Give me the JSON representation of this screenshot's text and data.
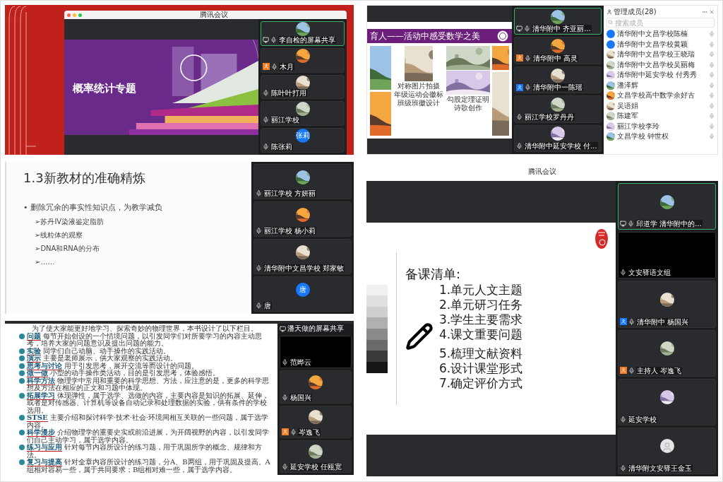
{
  "top_left": {
    "window_title": "腾讯会议",
    "slide_title": "概率统计专题",
    "tiles": [
      {
        "name": "李自检的屏幕共享",
        "screen": true,
        "active": true
      },
      {
        "name": "木月",
        "screen": false,
        "color": "#f07c28",
        "active": false
      },
      {
        "name": "陈叶叶打用",
        "screen": false,
        "active": false
      },
      {
        "name": "丽江学校",
        "screen": false,
        "active": false
      },
      {
        "name": "陈张莉",
        "avatar": {
          "kind": "letter",
          "text": "张莉"
        },
        "screen": false,
        "active": false
      }
    ]
  },
  "top_right": {
    "slide_title": "育人——活动中感受数学之美",
    "captions": [
      [
        "对称图片拍摄",
        "年级运动会徽标",
        "班级班徽设计"
      ],
      [
        "勾股定理证明",
        "诗歌创作"
      ]
    ],
    "tiles": [
      {
        "name": "清华附中 齐亚丽...",
        "screen": true,
        "active": true
      },
      {
        "name": "清华附中 高灵",
        "screen": false,
        "color": "#f07c28",
        "active": false
      },
      {
        "name": "清华附中一陈瑶",
        "screen": false,
        "color": "#1677ff",
        "active": false
      },
      {
        "name": "丽江学校罗丹丹",
        "screen": false,
        "active": false
      },
      {
        "name": "清华附中延安学校 付...",
        "screen": false,
        "active": false
      }
    ],
    "members_title": "管理成员(28)",
    "search_placeholder": "搜索成员",
    "members": [
      {
        "name": "清华附中文昌学校陈楠",
        "avatar": {
          "kind": "blue"
        }
      },
      {
        "name": "清华附中文昌学校黄颖",
        "avatar": {
          "kind": "blue"
        }
      },
      {
        "name": "清华附中文昌学校王晓瑞"
      },
      {
        "name": "清华附中文昌学校吴丽梅"
      },
      {
        "name": "清华附中延安学校 付秀秀"
      },
      {
        "name": "潘泽辉"
      },
      {
        "name": "文昌学校高中数学余好古"
      },
      {
        "name": "吴语娟"
      },
      {
        "name": "陈建军"
      },
      {
        "name": "丽江学校李玲"
      },
      {
        "name": "文昌学校 钟世权"
      }
    ]
  },
  "middle_left": {
    "slide_title": "1.3新教材的准确精炼",
    "bullet": "• 删除冗余的事实性知识点，为教学减负",
    "sub_items": [
      "➢苏丹IV染液鉴定脂肪",
      "➢线粒体的观察",
      "➢DNA和RNA的分布",
      "➢……"
    ],
    "tiles": [
      {
        "name": "丽江学校 方妍丽",
        "screen": false,
        "active": false
      },
      {
        "name": "丽江学校 杨小莉",
        "screen": false,
        "active": false
      },
      {
        "name": "清华附中文昌学校 郑家敏",
        "screen": false,
        "active": false
      },
      {
        "name": "唐",
        "avatar": {
          "kind": "letter",
          "text": "唐"
        },
        "screen": false,
        "active": false
      }
    ]
  },
  "bottom_left": {
    "share_label": "潘天做的屏幕共享",
    "intro": "为了使大家能更好地学习、探索奇妙的物理世界，本书设计了以下栏目。",
    "items": [
      {
        "term": "问题",
        "text": "每节开始创设的一个情境问题，以引发同学们对所要学习的内容主动思考，培养大家的问题意识及提出问题的能力。"
      },
      {
        "term": "实验",
        "text": "同学们自己动脑、动手操作的实践活动。"
      },
      {
        "term": "演示",
        "text": "主要是老师展示，供大家观察的实践活动。"
      },
      {
        "term": "思考与讨论",
        "text": "用于引发思考，展开交流等而设计的问题。"
      },
      {
        "term": "做一做",
        "text": "小型的动手操作类活动，目的是引发思考，体验感悟。"
      },
      {
        "term": "科学方法",
        "text": "物理学中常用和重要的科学思想、方法，应注意的是，更多的科学思想及方法在相应的正文和习题中体现。"
      },
      {
        "term": "拓展学习",
        "text": "体现弹性，属于选学、选做的内容，主要内容是知识的拓展、延伸，或者是对传感器、计算机等设备自动记录和处理数据的实验，供有条件的学校选用。"
      },
      {
        "term": "STSE",
        "text": "主要介绍和探讨科学·技术·社会·环境间相互关联的一些问题，属于选学内容。"
      },
      {
        "term": "科学漫步",
        "text": "介绍物理学的重要史实或前沿进展，为开阔视野的内容，以引发同学们自己主动学习，属于选学内容。"
      },
      {
        "term": "练习与应用",
        "text": "针对每节内容所设计的练习题，用于巩固所学的概念、规律和方法。"
      },
      {
        "term": "复习与提高",
        "text": "针对全章内容所设计的练习题，分A、B两组，用于巩固及提高。A组相对容易一些，属于共同要求；B组相对难一些，属于选学内容。"
      }
    ],
    "tiles": [
      {
        "name": "范晔云",
        "avatar": {
          "kind": "blank"
        },
        "screen": false,
        "active": false
      },
      {
        "name": "杨国兴",
        "screen": false,
        "active": false
      },
      {
        "name": "岑逸飞",
        "screen": false,
        "color": "#f07c28",
        "active": false
      },
      {
        "name": "延安学校 任瓯宽",
        "screen": false,
        "active": false
      }
    ]
  },
  "bottom_right": {
    "window_title": "腾讯会议",
    "heading": "备课清单:",
    "items": [
      "1.单元人文主题",
      "2.单元研习任务",
      "3.学生主要需求",
      "4.课文重要问题",
      "5.梳理文献资料",
      "6.设计课堂形式",
      "7.确定评价方式"
    ],
    "tiles": [
      {
        "name": "邱道学 清华附中的...",
        "screen": true,
        "active": true
      },
      {
        "name": "文安驿语文组",
        "avatar": {
          "kind": "blank"
        },
        "screen": false,
        "active": false
      },
      {
        "name": "清华附中 杨国兴",
        "screen": false,
        "color": "#1677ff",
        "active": false
      },
      {
        "name": "主持人 岑逸飞",
        "screen": false,
        "color": "#f07c28",
        "active": false
      },
      {
        "name": "延安学校",
        "screen": false,
        "active": false
      },
      {
        "name": "清华附文安驿王金玉",
        "avatar": {
          "kind": "silhouette"
        },
        "screen": false,
        "active": false
      }
    ]
  }
}
